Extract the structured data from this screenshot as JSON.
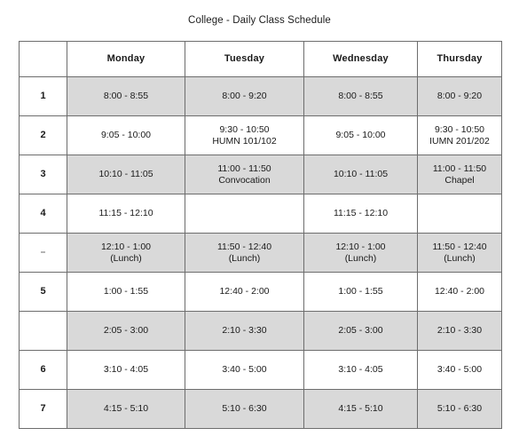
{
  "document": {
    "title": "College - Daily Class Schedule"
  },
  "table": {
    "columns": [
      {
        "key": "period",
        "label": ""
      },
      {
        "key": "monday",
        "label": "Monday"
      },
      {
        "key": "tuesday",
        "label": "Tuesday"
      },
      {
        "key": "wednesday",
        "label": "Wednesday"
      },
      {
        "key": "thursday",
        "label": "Thursday"
      }
    ],
    "shaded_color": "#d9d9d9",
    "border_color": "#6d6d6d",
    "rows": [
      {
        "period": "1",
        "shaded": true,
        "monday": {
          "time": "8:00 - 8:55",
          "note": ""
        },
        "tuesday": {
          "time": "8:00 - 9:20",
          "note": ""
        },
        "wednesday": {
          "time": "8:00 - 8:55",
          "note": ""
        },
        "thursday": {
          "time": "8:00 - 9:20",
          "note": ""
        }
      },
      {
        "period": "2",
        "shaded": false,
        "monday": {
          "time": "9:05 - 10:00",
          "note": ""
        },
        "tuesday": {
          "time": "9:30 - 10:50",
          "note": "HUMN 101/102"
        },
        "wednesday": {
          "time": "9:05 - 10:00",
          "note": ""
        },
        "thursday": {
          "time": "9:30 - 10:50",
          "note": "IUMN 201/202"
        }
      },
      {
        "period": "3",
        "shaded": true,
        "monday": {
          "time": "10:10 - 11:05",
          "note": ""
        },
        "tuesday": {
          "time": "11:00 - 11:50",
          "note": "Convocation"
        },
        "wednesday": {
          "time": "10:10 - 11:05",
          "note": ""
        },
        "thursday": {
          "time": "11:00 - 11:50",
          "note": "Chapel"
        }
      },
      {
        "period": "4",
        "shaded": false,
        "monday": {
          "time": "11:15 - 12:10",
          "note": ""
        },
        "tuesday": {
          "time": "",
          "note": ""
        },
        "wednesday": {
          "time": "11:15 - 12:10",
          "note": ""
        },
        "thursday": {
          "time": "",
          "note": ""
        }
      },
      {
        "period": "-",
        "shaded": true,
        "monday": {
          "time": "12:10 - 1:00",
          "note": "(Lunch)"
        },
        "tuesday": {
          "time": "11:50 - 12:40",
          "note": "(Lunch)"
        },
        "wednesday": {
          "time": "12:10 - 1:00",
          "note": "(Lunch)"
        },
        "thursday": {
          "time": "11:50 - 12:40",
          "note": "(Lunch)"
        }
      },
      {
        "period": "5",
        "shaded": false,
        "monday": {
          "time": "1:00 - 1:55",
          "note": ""
        },
        "tuesday": {
          "time": "12:40 - 2:00",
          "note": ""
        },
        "wednesday": {
          "time": "1:00 - 1:55",
          "note": ""
        },
        "thursday": {
          "time": "12:40 - 2:00",
          "note": ""
        }
      },
      {
        "period": "",
        "shaded": true,
        "monday": {
          "time": "2:05 - 3:00",
          "note": ""
        },
        "tuesday": {
          "time": "2:10 - 3:30",
          "note": ""
        },
        "wednesday": {
          "time": "2:05 - 3:00",
          "note": ""
        },
        "thursday": {
          "time": "2:10 - 3:30",
          "note": ""
        }
      },
      {
        "period": "6",
        "shaded": false,
        "monday": {
          "time": "3:10 - 4:05",
          "note": ""
        },
        "tuesday": {
          "time": "3:40 - 5:00",
          "note": ""
        },
        "wednesday": {
          "time": "3:10 - 4:05",
          "note": ""
        },
        "thursday": {
          "time": "3:40 - 5:00",
          "note": ""
        }
      },
      {
        "period": "7",
        "shaded": true,
        "monday": {
          "time": "4:15 - 5:10",
          "note": ""
        },
        "tuesday": {
          "time": "5:10 - 6:30",
          "note": ""
        },
        "wednesday": {
          "time": "4:15 - 5:10",
          "note": ""
        },
        "thursday": {
          "time": "5:10 - 6:30",
          "note": ""
        }
      }
    ]
  }
}
